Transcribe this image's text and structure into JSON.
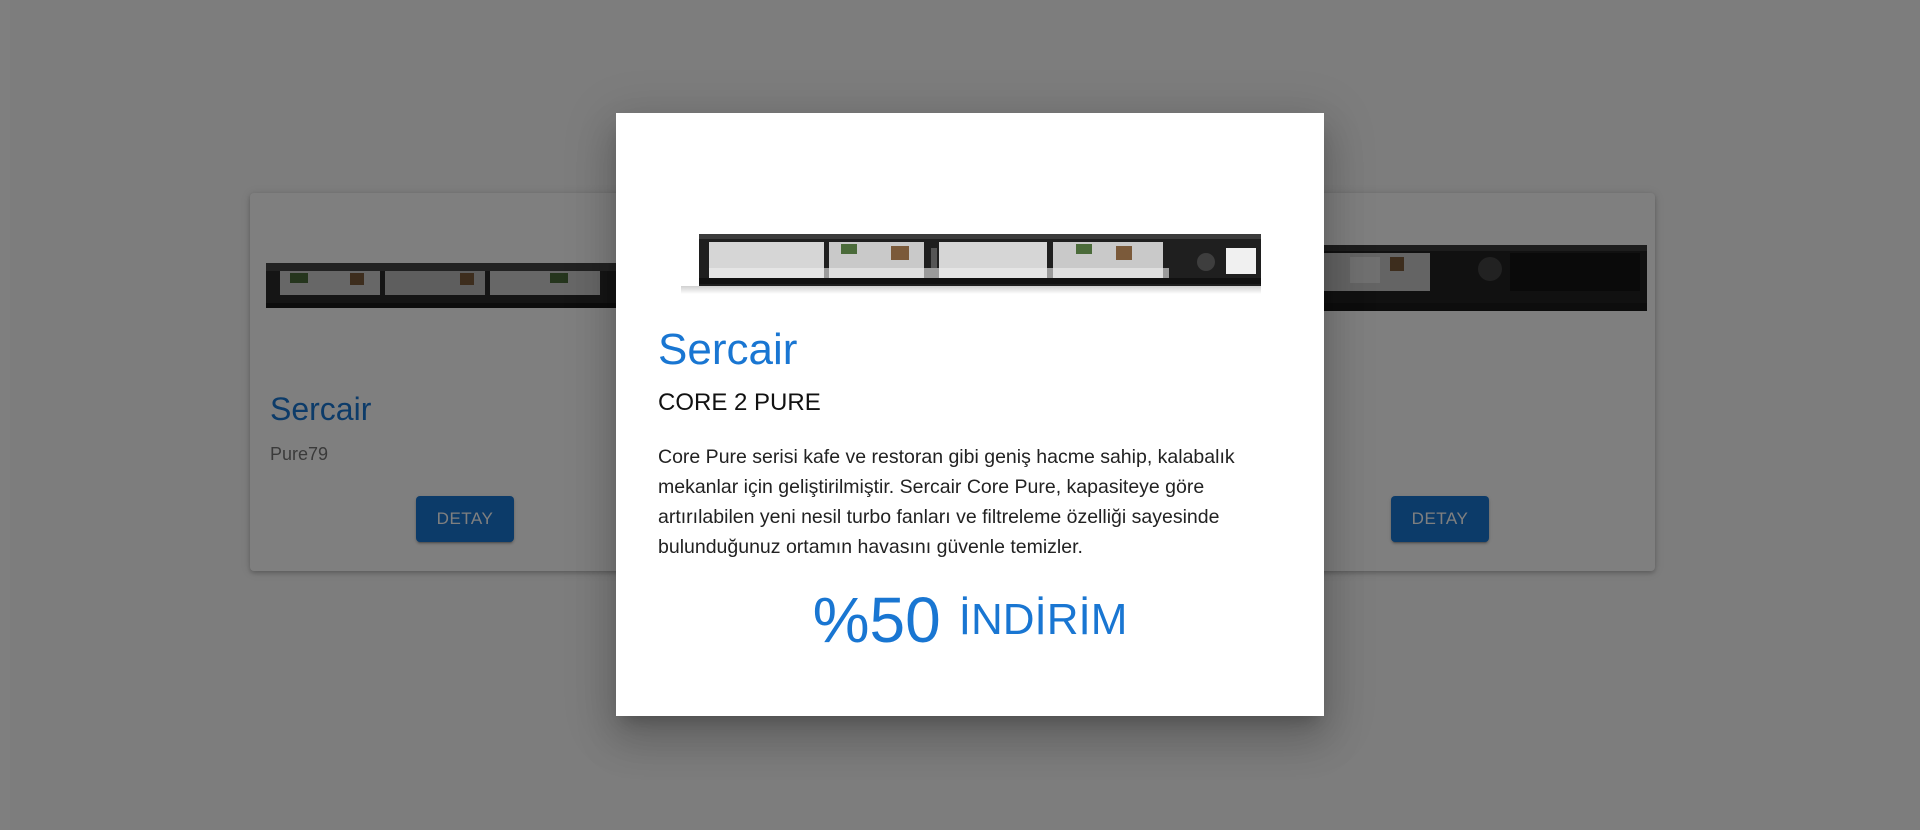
{
  "cards": [
    {
      "title": "Sercair",
      "subtitle": "Pure79",
      "button_label": "DETAY"
    },
    {
      "title": "",
      "subtitle": "",
      "button_label": "DETAY"
    }
  ],
  "modal": {
    "brand": "Sercair",
    "model": "CORE 2 PURE",
    "description": "Core Pure serisi kafe ve restoran gibi geniş hacme sahip, kalabalık mekanlar için geliştirilmiştir. Sercair Core Pure, kapasiteye göre artırılabilen yeni nesil turbo fanları ve filtreleme özelliği sayesinde bulunduğunuz ortamın havasını güvenle temizler.",
    "discount_value": "%50",
    "discount_label": "İNDİRİM"
  },
  "colors": {
    "accent": "#1976d2",
    "overlay": "rgba(0,0,0,0.5)"
  }
}
